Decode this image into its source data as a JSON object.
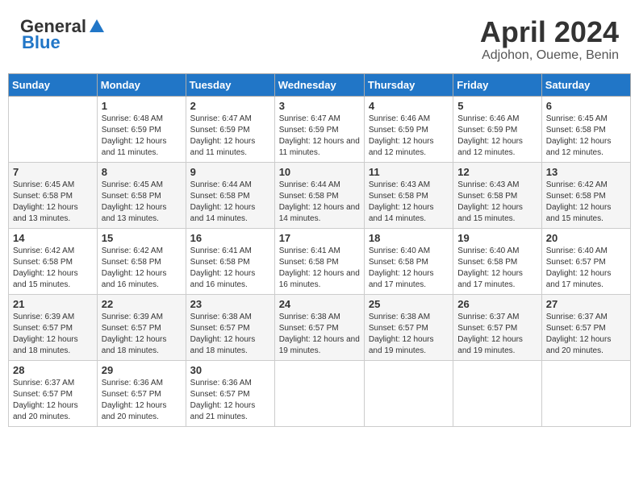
{
  "header": {
    "logo_general": "General",
    "logo_blue": "Blue",
    "month_title": "April 2024",
    "location": "Adjohon, Oueme, Benin"
  },
  "calendar": {
    "weekdays": [
      "Sunday",
      "Monday",
      "Tuesday",
      "Wednesday",
      "Thursday",
      "Friday",
      "Saturday"
    ],
    "weeks": [
      [
        {
          "day": "",
          "sunrise": "",
          "sunset": "",
          "daylight": ""
        },
        {
          "day": "1",
          "sunrise": "Sunrise: 6:48 AM",
          "sunset": "Sunset: 6:59 PM",
          "daylight": "Daylight: 12 hours and 11 minutes."
        },
        {
          "day": "2",
          "sunrise": "Sunrise: 6:47 AM",
          "sunset": "Sunset: 6:59 PM",
          "daylight": "Daylight: 12 hours and 11 minutes."
        },
        {
          "day": "3",
          "sunrise": "Sunrise: 6:47 AM",
          "sunset": "Sunset: 6:59 PM",
          "daylight": "Daylight: 12 hours and 11 minutes."
        },
        {
          "day": "4",
          "sunrise": "Sunrise: 6:46 AM",
          "sunset": "Sunset: 6:59 PM",
          "daylight": "Daylight: 12 hours and 12 minutes."
        },
        {
          "day": "5",
          "sunrise": "Sunrise: 6:46 AM",
          "sunset": "Sunset: 6:59 PM",
          "daylight": "Daylight: 12 hours and 12 minutes."
        },
        {
          "day": "6",
          "sunrise": "Sunrise: 6:45 AM",
          "sunset": "Sunset: 6:58 PM",
          "daylight": "Daylight: 12 hours and 12 minutes."
        }
      ],
      [
        {
          "day": "7",
          "sunrise": "Sunrise: 6:45 AM",
          "sunset": "Sunset: 6:58 PM",
          "daylight": "Daylight: 12 hours and 13 minutes."
        },
        {
          "day": "8",
          "sunrise": "Sunrise: 6:45 AM",
          "sunset": "Sunset: 6:58 PM",
          "daylight": "Daylight: 12 hours and 13 minutes."
        },
        {
          "day": "9",
          "sunrise": "Sunrise: 6:44 AM",
          "sunset": "Sunset: 6:58 PM",
          "daylight": "Daylight: 12 hours and 14 minutes."
        },
        {
          "day": "10",
          "sunrise": "Sunrise: 6:44 AM",
          "sunset": "Sunset: 6:58 PM",
          "daylight": "Daylight: 12 hours and 14 minutes."
        },
        {
          "day": "11",
          "sunrise": "Sunrise: 6:43 AM",
          "sunset": "Sunset: 6:58 PM",
          "daylight": "Daylight: 12 hours and 14 minutes."
        },
        {
          "day": "12",
          "sunrise": "Sunrise: 6:43 AM",
          "sunset": "Sunset: 6:58 PM",
          "daylight": "Daylight: 12 hours and 15 minutes."
        },
        {
          "day": "13",
          "sunrise": "Sunrise: 6:42 AM",
          "sunset": "Sunset: 6:58 PM",
          "daylight": "Daylight: 12 hours and 15 minutes."
        }
      ],
      [
        {
          "day": "14",
          "sunrise": "Sunrise: 6:42 AM",
          "sunset": "Sunset: 6:58 PM",
          "daylight": "Daylight: 12 hours and 15 minutes."
        },
        {
          "day": "15",
          "sunrise": "Sunrise: 6:42 AM",
          "sunset": "Sunset: 6:58 PM",
          "daylight": "Daylight: 12 hours and 16 minutes."
        },
        {
          "day": "16",
          "sunrise": "Sunrise: 6:41 AM",
          "sunset": "Sunset: 6:58 PM",
          "daylight": "Daylight: 12 hours and 16 minutes."
        },
        {
          "day": "17",
          "sunrise": "Sunrise: 6:41 AM",
          "sunset": "Sunset: 6:58 PM",
          "daylight": "Daylight: 12 hours and 16 minutes."
        },
        {
          "day": "18",
          "sunrise": "Sunrise: 6:40 AM",
          "sunset": "Sunset: 6:58 PM",
          "daylight": "Daylight: 12 hours and 17 minutes."
        },
        {
          "day": "19",
          "sunrise": "Sunrise: 6:40 AM",
          "sunset": "Sunset: 6:58 PM",
          "daylight": "Daylight: 12 hours and 17 minutes."
        },
        {
          "day": "20",
          "sunrise": "Sunrise: 6:40 AM",
          "sunset": "Sunset: 6:57 PM",
          "daylight": "Daylight: 12 hours and 17 minutes."
        }
      ],
      [
        {
          "day": "21",
          "sunrise": "Sunrise: 6:39 AM",
          "sunset": "Sunset: 6:57 PM",
          "daylight": "Daylight: 12 hours and 18 minutes."
        },
        {
          "day": "22",
          "sunrise": "Sunrise: 6:39 AM",
          "sunset": "Sunset: 6:57 PM",
          "daylight": "Daylight: 12 hours and 18 minutes."
        },
        {
          "day": "23",
          "sunrise": "Sunrise: 6:38 AM",
          "sunset": "Sunset: 6:57 PM",
          "daylight": "Daylight: 12 hours and 18 minutes."
        },
        {
          "day": "24",
          "sunrise": "Sunrise: 6:38 AM",
          "sunset": "Sunset: 6:57 PM",
          "daylight": "Daylight: 12 hours and 19 minutes."
        },
        {
          "day": "25",
          "sunrise": "Sunrise: 6:38 AM",
          "sunset": "Sunset: 6:57 PM",
          "daylight": "Daylight: 12 hours and 19 minutes."
        },
        {
          "day": "26",
          "sunrise": "Sunrise: 6:37 AM",
          "sunset": "Sunset: 6:57 PM",
          "daylight": "Daylight: 12 hours and 19 minutes."
        },
        {
          "day": "27",
          "sunrise": "Sunrise: 6:37 AM",
          "sunset": "Sunset: 6:57 PM",
          "daylight": "Daylight: 12 hours and 20 minutes."
        }
      ],
      [
        {
          "day": "28",
          "sunrise": "Sunrise: 6:37 AM",
          "sunset": "Sunset: 6:57 PM",
          "daylight": "Daylight: 12 hours and 20 minutes."
        },
        {
          "day": "29",
          "sunrise": "Sunrise: 6:36 AM",
          "sunset": "Sunset: 6:57 PM",
          "daylight": "Daylight: 12 hours and 20 minutes."
        },
        {
          "day": "30",
          "sunrise": "Sunrise: 6:36 AM",
          "sunset": "Sunset: 6:57 PM",
          "daylight": "Daylight: 12 hours and 21 minutes."
        },
        {
          "day": "",
          "sunrise": "",
          "sunset": "",
          "daylight": ""
        },
        {
          "day": "",
          "sunrise": "",
          "sunset": "",
          "daylight": ""
        },
        {
          "day": "",
          "sunrise": "",
          "sunset": "",
          "daylight": ""
        },
        {
          "day": "",
          "sunrise": "",
          "sunset": "",
          "daylight": ""
        }
      ]
    ]
  }
}
